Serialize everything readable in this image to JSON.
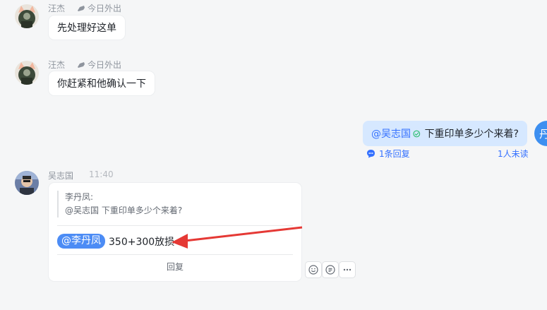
{
  "messages": [
    {
      "sender": "汪杰",
      "status": "今日外出",
      "text": "先处理好这单"
    },
    {
      "sender": "汪杰",
      "status": "今日外出",
      "text": "你赶紧和他确认一下"
    }
  ],
  "sent_message": {
    "mention": "@吴志国",
    "text": "下重印单多少个来着?",
    "thread_replies": "1条回复",
    "unread": "1人未读",
    "avatar_text": "丹"
  },
  "reply_card": {
    "sender": "吴志国",
    "time": "11:40",
    "quote_author": "李丹凤:",
    "quote_text": "@吴志国 下重印单多少个来着?",
    "mention_chip": "@李丹凤",
    "text": "350+300放损",
    "reply_button": "回复"
  },
  "colors": {
    "accent": "#3370ff",
    "annotation_arrow": "#e53935",
    "sent_bubble": "#d6e8ff"
  },
  "icons": [
    "status-car-icon",
    "thread-reply-icon",
    "read-check-icon",
    "emoji-icon",
    "reply-icon",
    "more-icon"
  ]
}
